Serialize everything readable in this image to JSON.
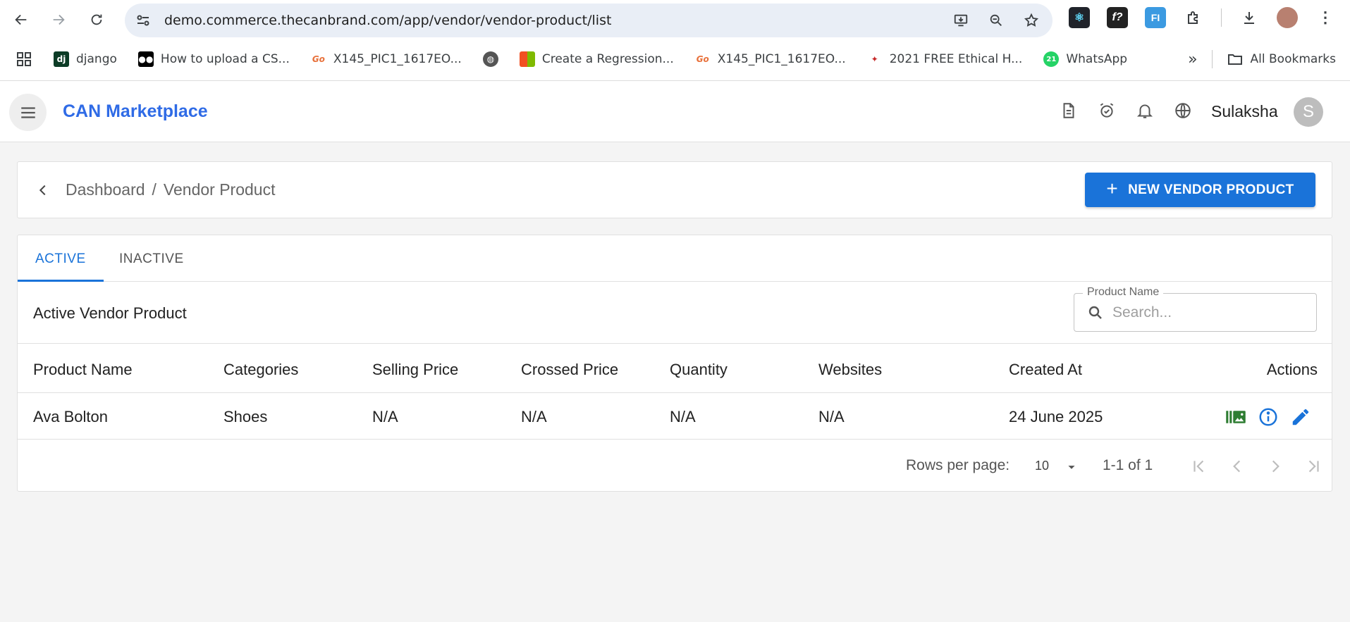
{
  "browser": {
    "url": "demo.commerce.thecanbrand.com/app/vendor/vendor-product/list",
    "bookmarks": [
      {
        "label": "django"
      },
      {
        "label": "How to upload a CS..."
      },
      {
        "label": "X145_PIC1_1617EO..."
      },
      {
        "label": "Create a Regression..."
      },
      {
        "label": "X145_PIC1_1617EO..."
      },
      {
        "label": "2021 FREE Ethical H..."
      },
      {
        "label": "WhatsApp"
      }
    ],
    "all_bookmarks": "All Bookmarks"
  },
  "header": {
    "brand": "CAN Marketplace",
    "username": "Sulaksha",
    "avatar_initial": "S"
  },
  "breadcrumb": {
    "items": [
      "Dashboard",
      "Vendor Product"
    ],
    "separator": "/"
  },
  "new_button": {
    "label": "NEW VENDOR PRODUCT"
  },
  "tabs": [
    {
      "label": "ACTIVE",
      "active": true
    },
    {
      "label": "INACTIVE",
      "active": false
    }
  ],
  "section_title": "Active Vendor Product",
  "search": {
    "label": "Product Name",
    "placeholder": "Search...",
    "value": ""
  },
  "table": {
    "columns": [
      "Product Name",
      "Categories",
      "Selling Price",
      "Crossed Price",
      "Quantity",
      "Websites",
      "Created At",
      "Actions"
    ],
    "rows": [
      {
        "product_name": "Ava Bolton",
        "categories": "Shoes",
        "selling_price": "N/A",
        "crossed_price": "N/A",
        "quantity": "N/A",
        "websites": "N/A",
        "created_at": "24 June 2025"
      }
    ]
  },
  "pagination": {
    "rows_per_page_label": "Rows per page:",
    "rows_per_page": "10",
    "range": "1-1 of 1"
  },
  "colors": {
    "primary": "#1a73d9",
    "brand": "#2f6be6",
    "gallery_icon": "#2e7d32",
    "info_icon": "#1a73d9",
    "edit_icon": "#1a73d9"
  }
}
